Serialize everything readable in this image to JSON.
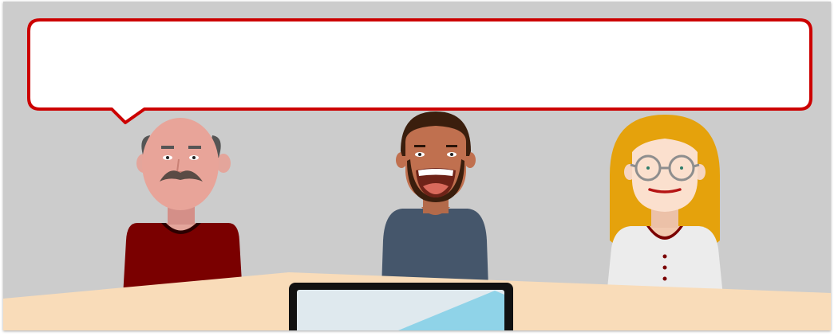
{
  "speech_bubble": {
    "text": "",
    "border_color": "#cc0000",
    "fill_color": "#ffffff"
  },
  "colors": {
    "background": "#cccccc",
    "table": "#f9dcb9",
    "laptop_frame": "#111111",
    "laptop_screen": "#dfe9ee",
    "laptop_screen_glare": "#8fd3e8",
    "person_left_shirt": "#7a0000",
    "person_middle_shirt": "#45566b",
    "person_right_shirt": "#ececec",
    "person_right_hair": "#e5a20c"
  },
  "people": [
    {
      "role": "speaker",
      "icon": "bald-man-with-mustache"
    },
    {
      "role": "listener",
      "icon": "smiling-man-with-beard"
    },
    {
      "role": "listener",
      "icon": "woman-with-glasses"
    }
  ]
}
